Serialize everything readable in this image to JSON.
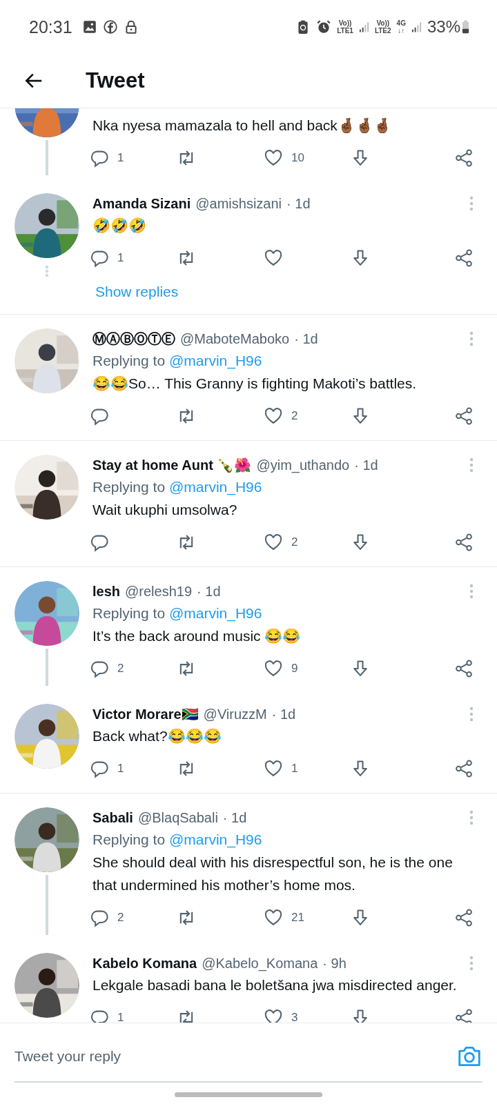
{
  "status_bar": {
    "time": "20:31",
    "sims": [
      {
        "volte": "Vo))",
        "band": "LTE1"
      },
      {
        "volte": "Vo))",
        "band": "LTE2",
        "data": "4G",
        "arrows": "↓↑"
      }
    ],
    "battery": "33%"
  },
  "header": {
    "title": "Tweet"
  },
  "tweets": [
    {
      "text": "Nka nyesa mamazala to hell and back🤞🏾🤞🏾🤞🏾",
      "replies": "1",
      "likes": "10",
      "thread_below": true
    },
    {
      "name": "Amanda Sizani",
      "handle": "@amishsizani",
      "time": "· 1d",
      "text": "🤣🤣🤣",
      "replies": "1",
      "thread_below": false,
      "show_replies": "Show replies"
    },
    {
      "name": "ⓂⒶⒷⓄⓉⒺ",
      "handle": "@MaboteMaboko",
      "time": "· 1d",
      "reply_label": "Replying to",
      "reply_to": "@marvin_H96",
      "text": "😂😂So… This Granny is fighting Makoti’s battles.",
      "likes": "2",
      "thread_below": false
    },
    {
      "name": "Stay at home Aunt 🍾🌺",
      "handle": "@yim_uthando",
      "time": "· 1d",
      "reply_label": "Replying to",
      "reply_to": "@marvin_H96",
      "text": "Wait ukuphi umsolwa?",
      "likes": "2",
      "thread_below": false
    },
    {
      "name": "lesh",
      "handle": "@relesh19",
      "time": "· 1d",
      "reply_label": "Replying to",
      "reply_to": "@marvin_H96",
      "text": "It’s the back around music 😂😂",
      "replies": "2",
      "likes": "9",
      "thread_below": true
    },
    {
      "name": "Victor Morare🇿🇦",
      "handle": "@ViruzzM",
      "time": "· 1d",
      "text": "Back what?😂😂😂",
      "replies": "1",
      "likes": "1",
      "thread_below": false
    },
    {
      "name": "Sabali",
      "handle": "@BlaqSabali",
      "time": "· 1d",
      "reply_label": "Replying to",
      "reply_to": "@marvin_H96",
      "text": "She should deal with his disrespectful son, he is the one that undermined his mother’s home mos.",
      "replies": "2",
      "likes": "21",
      "thread_below": true
    },
    {
      "name": "Kabelo Komana",
      "handle": "@Kabelo_Komana",
      "time": "· 9h",
      "text": "Lekgale basadi bana le boletšana jwa misdirected anger.",
      "replies": "1",
      "likes": "3",
      "thread_below": false
    }
  ],
  "reply_bar": {
    "placeholder": "Tweet your reply"
  }
}
